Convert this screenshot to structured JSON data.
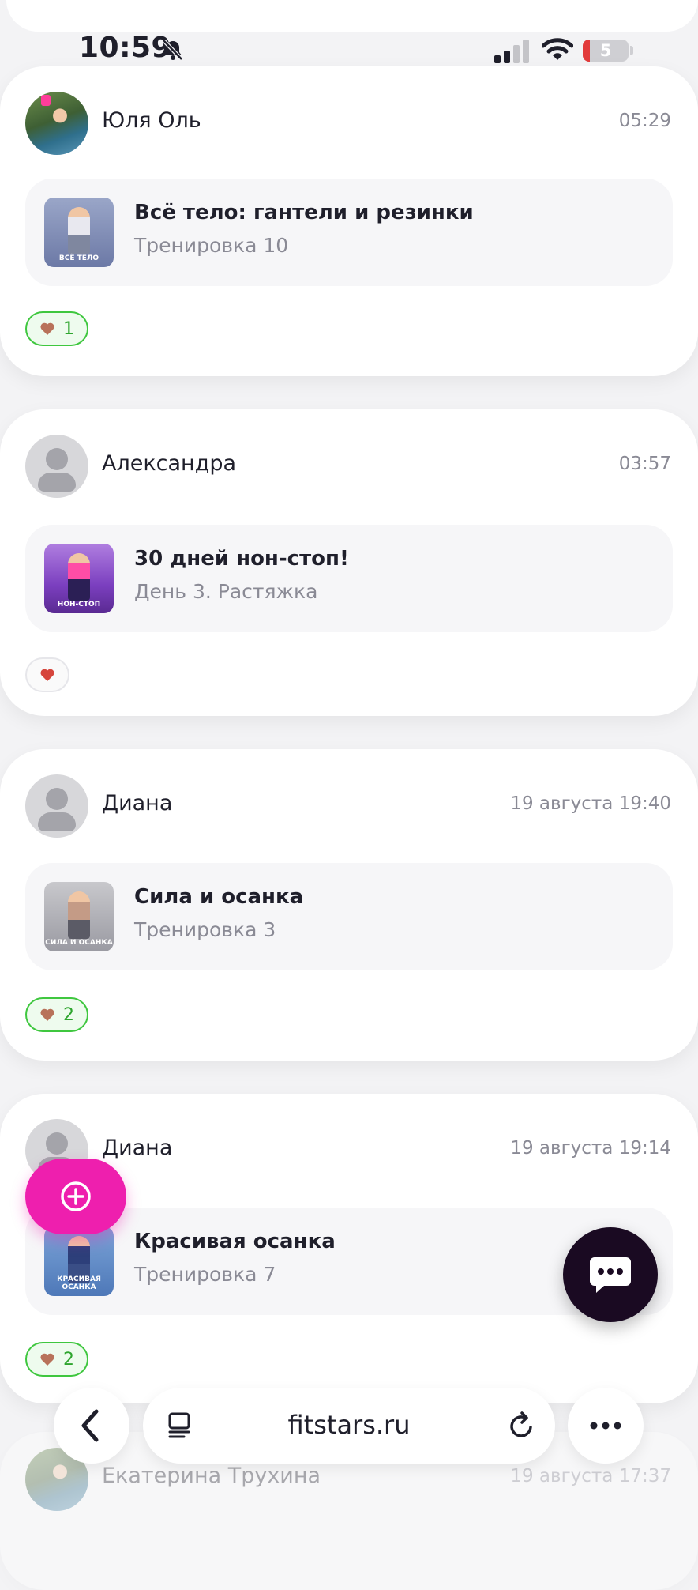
{
  "status_bar": {
    "time": "10:59",
    "battery_level": "5"
  },
  "feed": [
    {
      "user": "Юля Оль",
      "time": "05:29",
      "workout_title": "Всё тело: гантели и резинки",
      "workout_subtitle": "Тренировка 10",
      "thumb_caption": "ВСЁ ТЕЛО",
      "likes": "1"
    },
    {
      "user": "Александра",
      "time": "03:57",
      "workout_title": "30 дней нон-стоп!",
      "workout_subtitle": "День 3. Растяжка",
      "thumb_caption": "НОН-СТОП",
      "likes": ""
    },
    {
      "user": "Диана",
      "time": "19 августа 19:40",
      "workout_title": "Сила и осанка",
      "workout_subtitle": "Тренировка 3",
      "thumb_caption": "СИЛА И ОСАНКА",
      "likes": "2"
    },
    {
      "user": "Диана",
      "time": "19 августа 19:14",
      "workout_title": "Красивая осанка",
      "workout_subtitle": "Тренировка 7",
      "thumb_caption": "КРАСИВАЯ ОСАНКА",
      "likes": "2"
    },
    {
      "user": "Екатерина Трухина",
      "time": "19 августа 17:37"
    }
  ],
  "browser": {
    "url": "fitstars.ru"
  },
  "colors": {
    "accent_pink": "#ee1fae",
    "chat_dark": "#1a0a22",
    "like_green": "#3fc73f"
  }
}
